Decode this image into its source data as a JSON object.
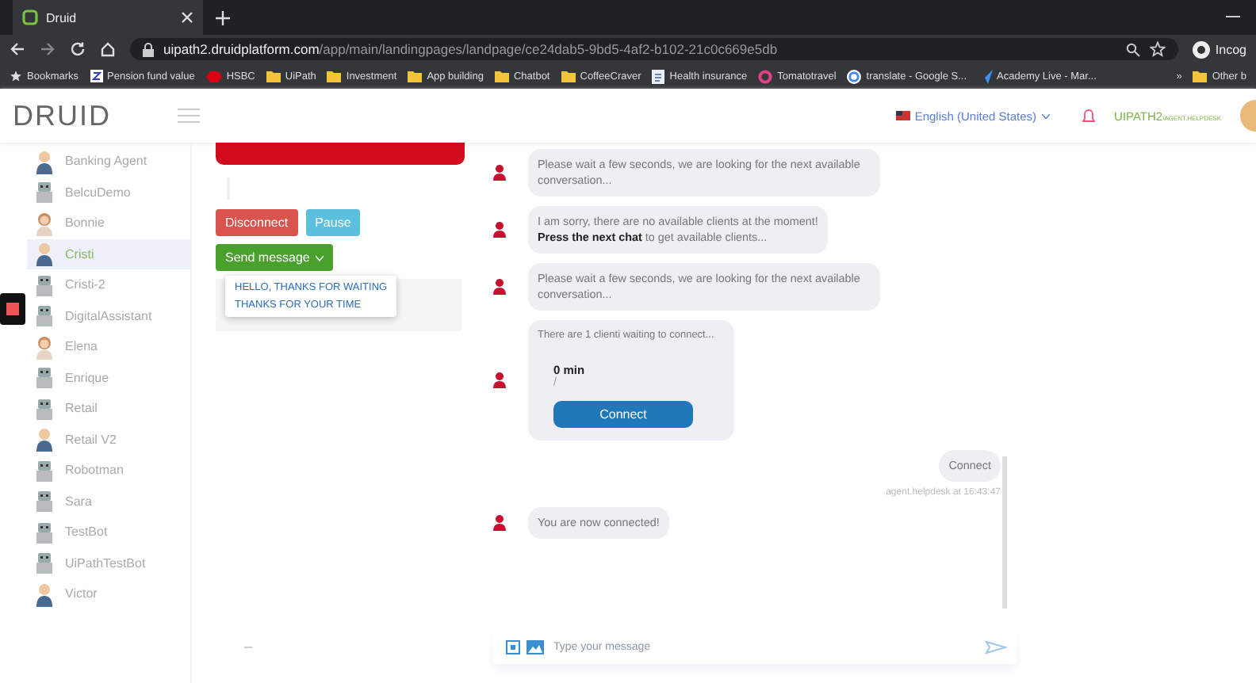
{
  "browser": {
    "tab": {
      "title": "Druid"
    },
    "address": {
      "domain": "uipath2.druidplatform.com",
      "path": "/app/main/landingpages/landpage/ce24dab5-9bd5-4af2-b102-21c0c669e5db"
    },
    "profile": "Incog",
    "bookmarks": [
      {
        "label": "Bookmarks",
        "kind": "star"
      },
      {
        "label": "Pension fund value",
        "kind": "z"
      },
      {
        "label": "HSBC",
        "kind": "hsbc"
      },
      {
        "label": "UiPath",
        "kind": "folder"
      },
      {
        "label": "Investment",
        "kind": "folder"
      },
      {
        "label": "App building",
        "kind": "folder"
      },
      {
        "label": "Chatbot",
        "kind": "folder"
      },
      {
        "label": "CoffeeCraver",
        "kind": "folder"
      },
      {
        "label": "Health insurance",
        "kind": "page"
      },
      {
        "label": "Tomatotravel",
        "kind": "ring"
      },
      {
        "label": "translate - Google S...",
        "kind": "google"
      },
      {
        "label": "Academy Live - Mar...",
        "kind": "arrow"
      }
    ],
    "more": "»",
    "other": "Other b"
  },
  "header": {
    "logo": "DRUID",
    "language": "English (United States)",
    "user": "UIPATH2",
    "user_sub": "\\AGENT.HELPDESK"
  },
  "agents": [
    {
      "name": "Banking Agent",
      "kind": "person",
      "selected": false
    },
    {
      "name": "BelcuDemo",
      "kind": "robot",
      "selected": false
    },
    {
      "name": "Bonnie",
      "kind": "woman",
      "selected": false
    },
    {
      "name": "Cristi",
      "kind": "person",
      "selected": true
    },
    {
      "name": "Cristi-2",
      "kind": "robot",
      "selected": false
    },
    {
      "name": "DigitalAssistant",
      "kind": "robot",
      "selected": false
    },
    {
      "name": "Elena",
      "kind": "woman",
      "selected": false
    },
    {
      "name": "Enrique",
      "kind": "robot",
      "selected": false
    },
    {
      "name": "Retail",
      "kind": "robot",
      "selected": false
    },
    {
      "name": "Retail V2",
      "kind": "person",
      "selected": false
    },
    {
      "name": "Robotman",
      "kind": "robot",
      "selected": false
    },
    {
      "name": "Sara",
      "kind": "robot",
      "selected": false
    },
    {
      "name": "TestBot",
      "kind": "robot",
      "selected": false
    },
    {
      "name": "UiPathTestBot",
      "kind": "robot",
      "selected": false
    },
    {
      "name": "Victor",
      "kind": "person",
      "selected": false
    }
  ],
  "controls": {
    "buttons": [
      {
        "label": "Disconnect",
        "kind": "danger"
      },
      {
        "label": "Pause",
        "kind": "info"
      }
    ],
    "send": {
      "label": "Send message",
      "expanded": true,
      "options": [
        "HELLO, THANKS FOR WAITING",
        "THANKS FOR YOUR TIME"
      ]
    }
  },
  "chat": {
    "messages": [
      {
        "kind": "bot",
        "text": "Please wait a few seconds, we are looking for the next available conversation..."
      },
      {
        "kind": "bot",
        "text": "I am sorry, there are no available clients at the moment!\n**Press the next chat** to get available clients..."
      },
      {
        "kind": "bot",
        "text": "Please wait a few seconds, we are looking for the next available conversation..."
      },
      {
        "kind": "card",
        "text": "There are 1 clienti waiting to connect...",
        "time": "0 min",
        "detail": "/",
        "button": "Connect"
      },
      {
        "kind": "user",
        "text": "Connect",
        "meta": "agent.helpdesk at 16:43:47"
      },
      {
        "kind": "bot",
        "text": "You are now connected!"
      }
    ],
    "input": {
      "placeholder": "Type your message"
    }
  }
}
